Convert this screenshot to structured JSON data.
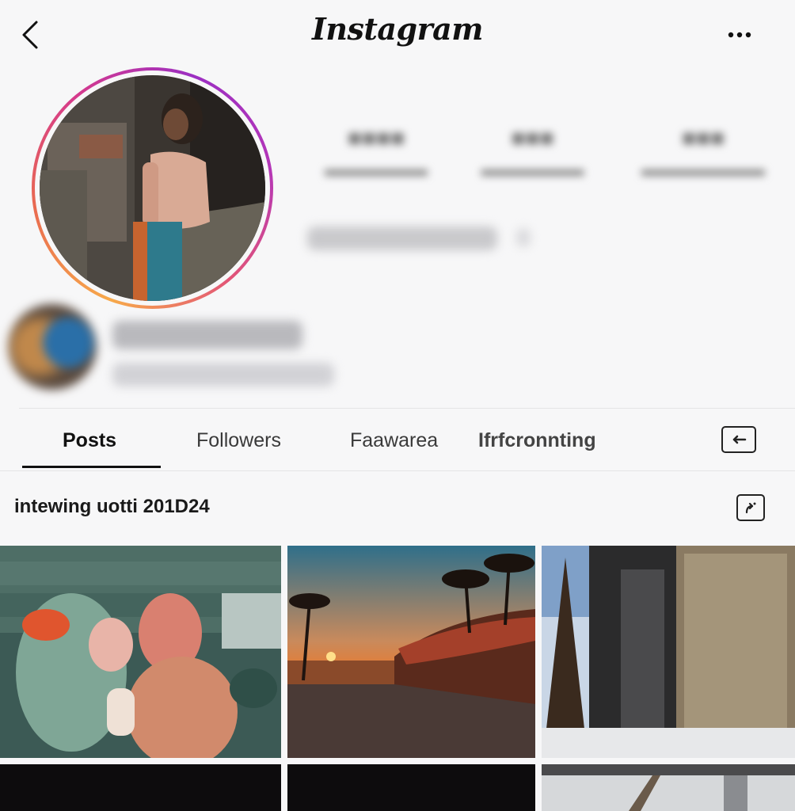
{
  "header": {
    "title": "Instagram",
    "back_icon": "chevron-left-icon",
    "more_icon": "more-horizontal-icon"
  },
  "tabs": [
    {
      "label": "Posts",
      "active": true
    },
    {
      "label": "Followers",
      "active": false
    },
    {
      "label": "Faawarea",
      "active": false
    },
    {
      "label": "Ifrfcronnting",
      "active": false
    }
  ],
  "section": {
    "title": "intewing uotti 201D24"
  },
  "colors": {
    "ring_start": "#f7a94a",
    "ring_mid": "#d63a8c",
    "ring_end": "#9c2fc2",
    "background": "#f7f7f8"
  }
}
